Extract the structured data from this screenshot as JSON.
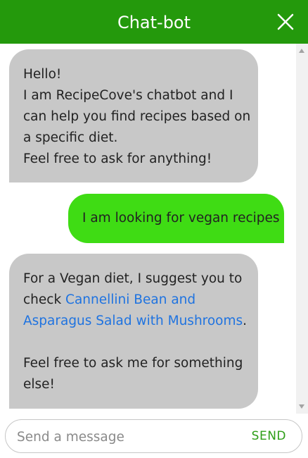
{
  "header": {
    "title": "Chat-bot",
    "close_icon": "close-icon",
    "background": "#24990c"
  },
  "messages": [
    {
      "sender": "bot",
      "lines": [
        "Hello!",
        "I am RecipeCove's chatbot and I",
        "can help you find recipes based on",
        "a specific diet.",
        "Feel free to ask for anything!"
      ]
    },
    {
      "sender": "user",
      "text": "I am looking for vegan recipes"
    },
    {
      "sender": "bot",
      "intro": "For a Vegan diet, I suggest you to",
      "prefix": "check ",
      "link_line1": "Cannellini Bean and",
      "link_line2": "Asparagus Salad with Mushrooms",
      "suffix": ".",
      "outro_line1": "Feel free to ask me for something",
      "outro_line2": "else!"
    }
  ],
  "composer": {
    "placeholder": "Send a message",
    "send_label": "SEND"
  },
  "colors": {
    "bot_bubble": "#c8c8c8",
    "user_bubble": "#3fdc14",
    "link": "#1f73e0",
    "send": "#2d9e17"
  }
}
